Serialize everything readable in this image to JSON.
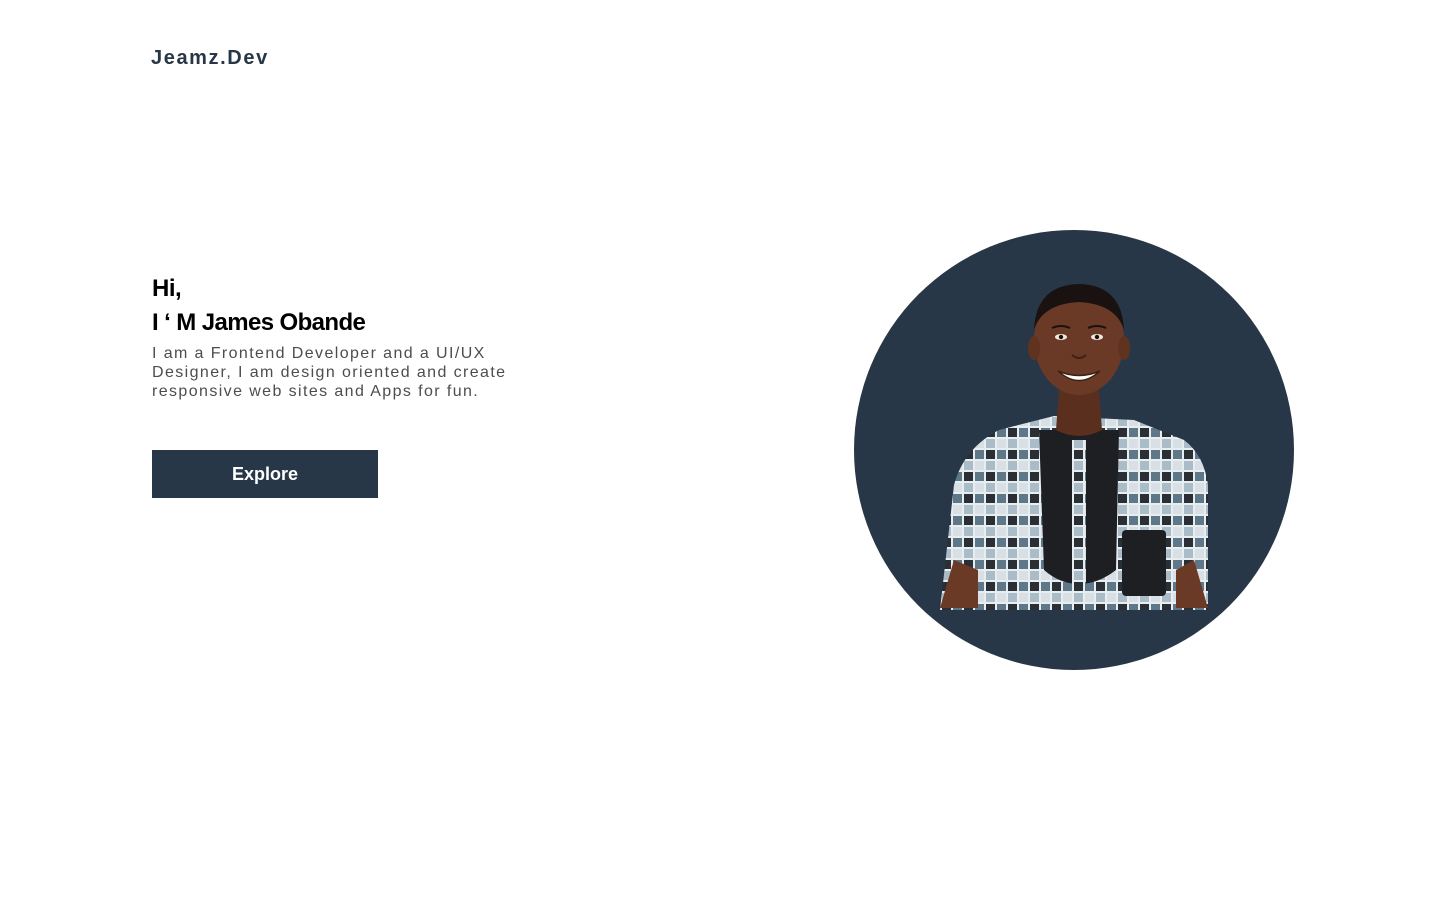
{
  "header": {
    "logo_text": "Jeamz.Dev"
  },
  "hero": {
    "greeting": "Hi,",
    "name": "I ‘ M James Obande",
    "bio": "I am a Frontend Developer and a UI/UX\nDesigner,  I am design oriented and create\nresponsive web sites and Apps for fun.",
    "cta_label": "Explore"
  },
  "portrait": {
    "subject": "profile-photo"
  },
  "colors": {
    "brand": "#283747",
    "text": "#000000",
    "muted_text": "#4d4d4d",
    "background": "#ffffff"
  }
}
